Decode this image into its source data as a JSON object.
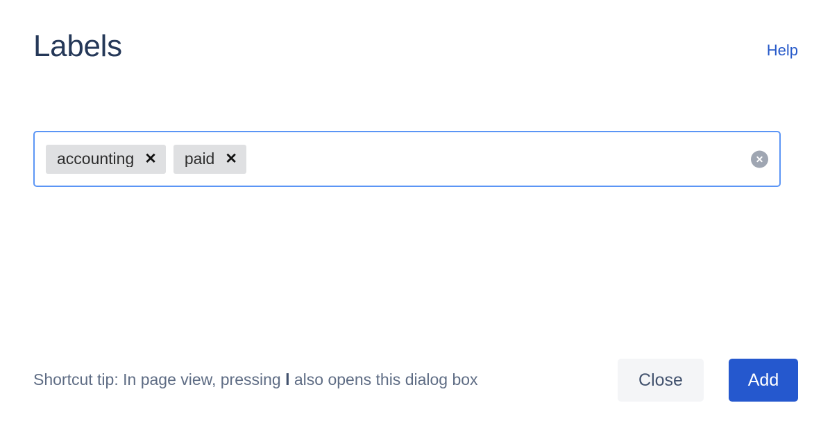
{
  "dialog": {
    "title": "Labels",
    "help_link_label": "Help"
  },
  "tag_input": {
    "placeholder": "",
    "value": "",
    "clear_icon": "clear-circle-icon",
    "chips": [
      {
        "label": "accounting",
        "remove_glyph": "✕"
      },
      {
        "label": "paid",
        "remove_glyph": "✕"
      }
    ]
  },
  "footer": {
    "shortcut_tip_prefix": "Shortcut tip: In page view, pressing ",
    "shortcut_key": "l",
    "shortcut_tip_suffix": " also opens this dialog box",
    "close_label": "Close",
    "add_label": "Add"
  },
  "colors": {
    "title": "#253858",
    "link": "#2659c9",
    "focus_border": "#5b95f5",
    "chip_bg": "#dfe0e2",
    "primary_button": "#2558ce",
    "secondary_button": "#f4f5f7",
    "muted_text": "#5e6c84",
    "clear_icon_bg": "#9fa6b2"
  }
}
